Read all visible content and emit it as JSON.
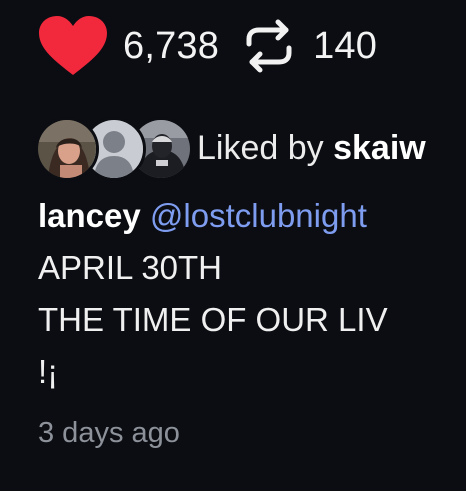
{
  "colors": {
    "background": "#0b0d12",
    "like_heart": "#f2283c",
    "mention": "#7f9df0",
    "muted": "#8d9199",
    "text": "#f0f0f0"
  },
  "actions": {
    "like_icon": "heart-filled-icon",
    "like_count": "6,738",
    "repost_icon": "repost-icon",
    "repost_count": "140"
  },
  "liked_by": {
    "avatars": [
      "avatar-photo",
      "avatar-placeholder",
      "avatar-photo"
    ],
    "prefix": "Liked by ",
    "user": "skaiw"
  },
  "caption": {
    "author": "lancey",
    "mention": "@lostclubnight",
    "lines": [
      "APRIL 30TH",
      "THE TIME OF OUR LIV",
      "!¡"
    ]
  },
  "timestamp": "3 days ago"
}
